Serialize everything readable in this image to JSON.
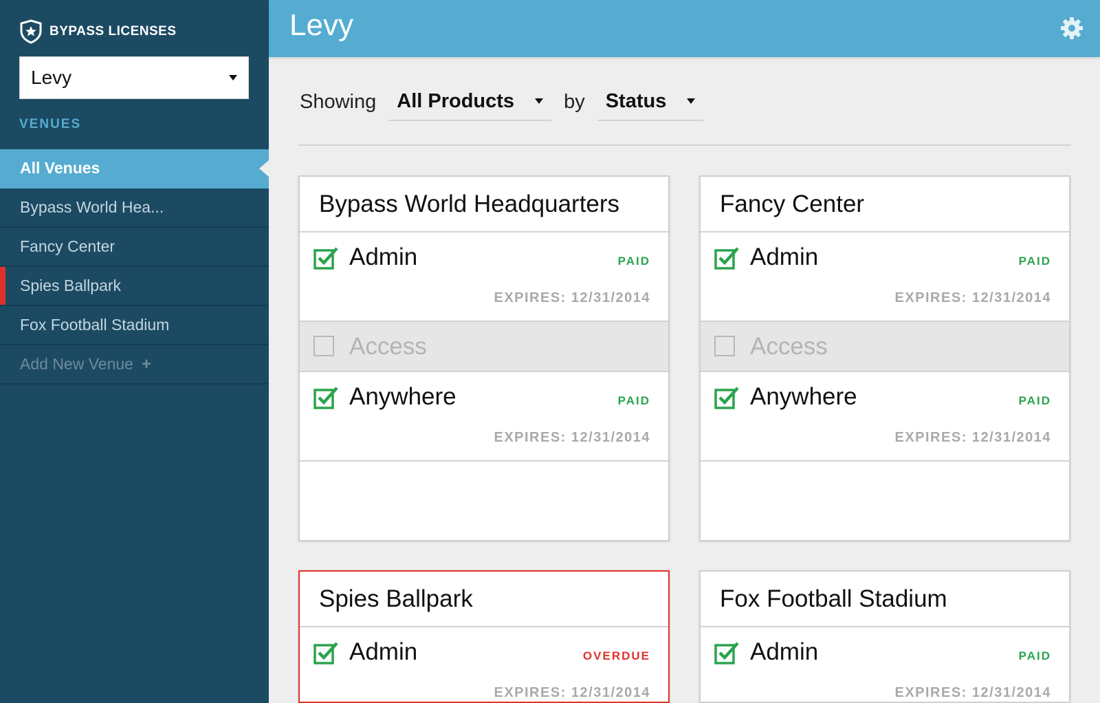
{
  "app": {
    "brand_name": "BYPASS LICENSES"
  },
  "sidebar": {
    "org_select_value": "Levy",
    "section_label": "VENUES",
    "items": [
      {
        "label": "All Venues"
      },
      {
        "label": "Bypass World Hea..."
      },
      {
        "label": "Fancy Center"
      },
      {
        "label": "Spies Ballpark"
      },
      {
        "label": "Fox Football Stadium"
      }
    ],
    "add_label": "Add New Venue",
    "add_icon": "+"
  },
  "header": {
    "title": "Levy"
  },
  "filters": {
    "showing_label": "Showing",
    "product_value": "All Products",
    "by_label": "by",
    "group_value": "Status"
  },
  "venues": [
    {
      "name": "Bypass World Headquarters",
      "licenses": [
        {
          "name": "Admin",
          "checked": true,
          "status": "PAID",
          "expires": "EXPIRES: 12/31/2014"
        },
        {
          "name": "Access",
          "checked": false
        },
        {
          "name": "Anywhere",
          "checked": true,
          "status": "PAID",
          "expires": "EXPIRES: 12/31/2014"
        }
      ]
    },
    {
      "name": "Fancy Center",
      "licenses": [
        {
          "name": "Admin",
          "checked": true,
          "status": "PAID",
          "expires": "EXPIRES: 12/31/2014"
        },
        {
          "name": "Access",
          "checked": false
        },
        {
          "name": "Anywhere",
          "checked": true,
          "status": "PAID",
          "expires": "EXPIRES: 12/31/2014"
        }
      ]
    },
    {
      "name": "Spies Ballpark",
      "licenses": [
        {
          "name": "Admin",
          "checked": true,
          "status": "OVERDUE",
          "expires": "EXPIRES: 12/31/2014"
        }
      ]
    },
    {
      "name": "Fox Football Stadium",
      "licenses": [
        {
          "name": "Admin",
          "checked": true,
          "status": "PAID",
          "expires": "EXPIRES: 12/31/2014"
        }
      ]
    }
  ],
  "colors": {
    "sidebar_bg": "#1c4a63",
    "accent": "#55acd0",
    "paid": "#2aa44d",
    "overdue": "#e0322b"
  },
  "icons": {
    "brand": "shield-star-icon",
    "settings": "gear-icon",
    "checked": "checkbox-checked-icon",
    "unchecked": "checkbox-unchecked-icon"
  }
}
